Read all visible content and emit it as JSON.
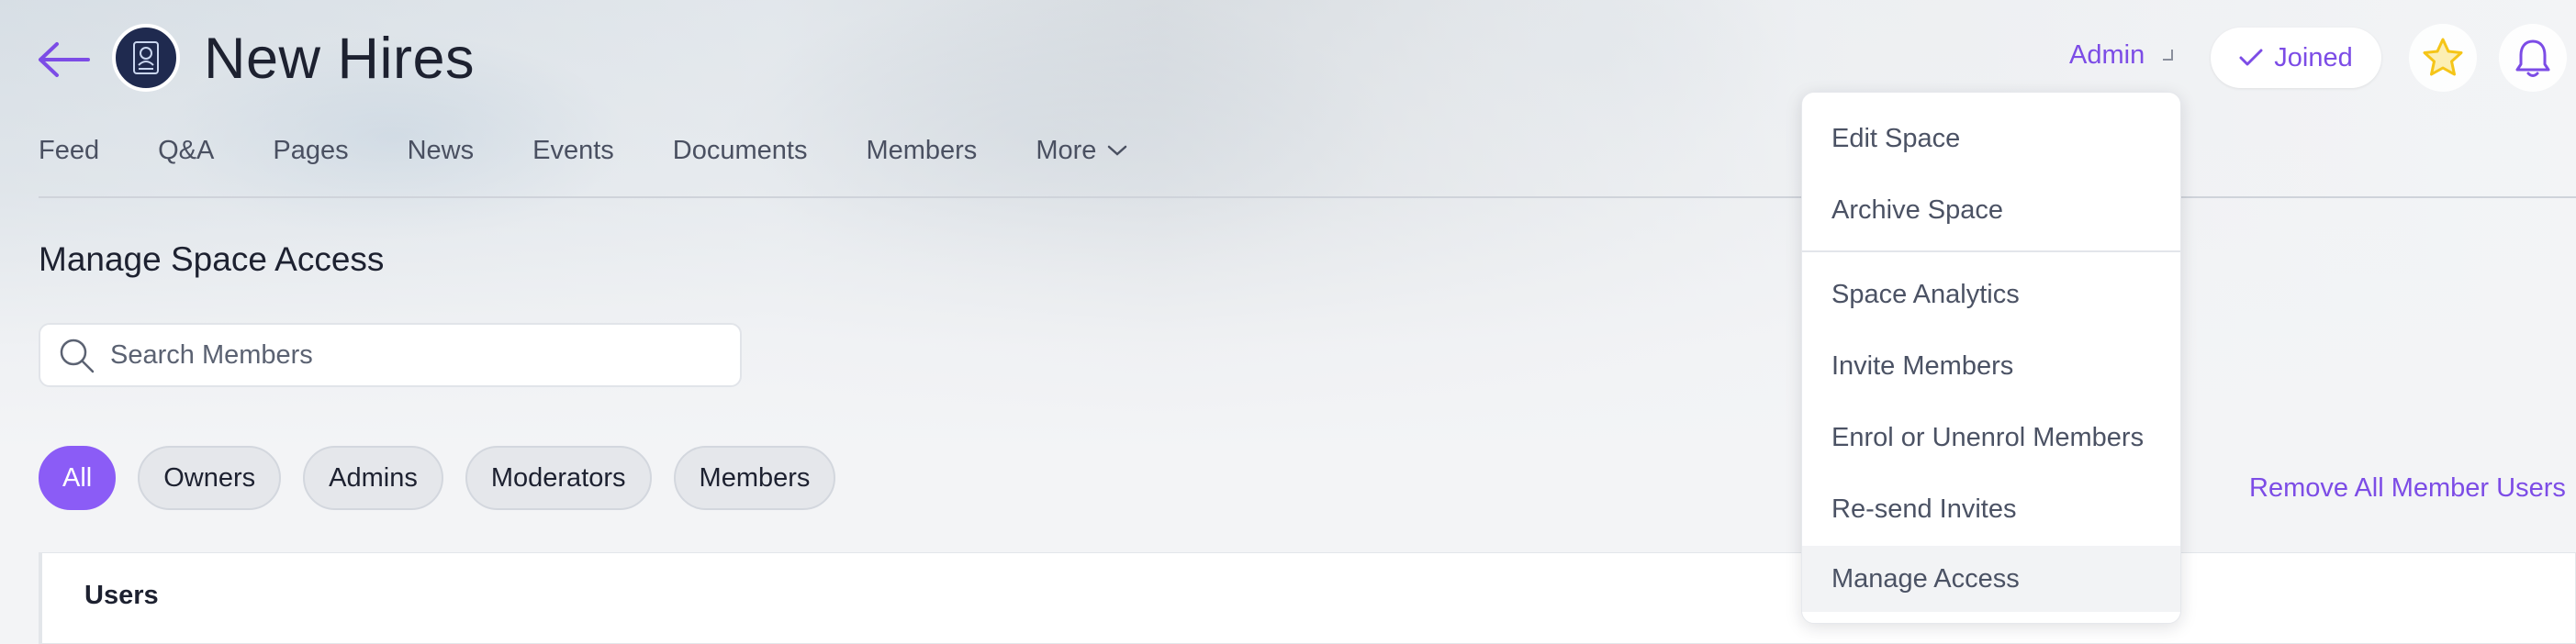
{
  "header": {
    "space_title": "New Hires",
    "role_label": "Admin",
    "joined_label": "Joined"
  },
  "tabs": [
    {
      "label": "Feed"
    },
    {
      "label": "Q&A"
    },
    {
      "label": "Pages"
    },
    {
      "label": "News"
    },
    {
      "label": "Events"
    },
    {
      "label": "Documents"
    },
    {
      "label": "Members"
    },
    {
      "label": "More"
    }
  ],
  "main": {
    "section_title": "Manage Space Access",
    "search": {
      "placeholder": "Search Members",
      "value": ""
    },
    "filters": [
      {
        "label": "All",
        "active": true
      },
      {
        "label": "Owners",
        "active": false
      },
      {
        "label": "Admins",
        "active": false
      },
      {
        "label": "Moderators",
        "active": false
      },
      {
        "label": "Members",
        "active": false
      }
    ],
    "remove_all_label": "Remove All Member Users",
    "users_panel_title": "Users"
  },
  "admin_menu": {
    "items": [
      {
        "label": "Edit Space"
      },
      {
        "label": "Archive Space"
      },
      {
        "label": "Space Analytics"
      },
      {
        "label": "Invite Members"
      },
      {
        "label": "Enrol or Unenrol Members"
      },
      {
        "label": "Re-send Invites"
      },
      {
        "label": "Manage Access",
        "highlighted": true
      }
    ]
  },
  "icons": {
    "back": "arrow-left-icon",
    "logo": "id-badge-icon",
    "role_caret": "corner-caret-icon",
    "joined": "check-icon",
    "favorite": "star-icon",
    "notifications": "bell-icon",
    "more": "chevron-down-icon",
    "search": "search-icon"
  },
  "colors": {
    "accent": "#7c4ce6",
    "chip_active": "#8b5cf6",
    "star": "#f5c518",
    "logo_bg": "#1f2a4f",
    "text_dark": "#1d2130",
    "text_muted": "#4b5264"
  }
}
